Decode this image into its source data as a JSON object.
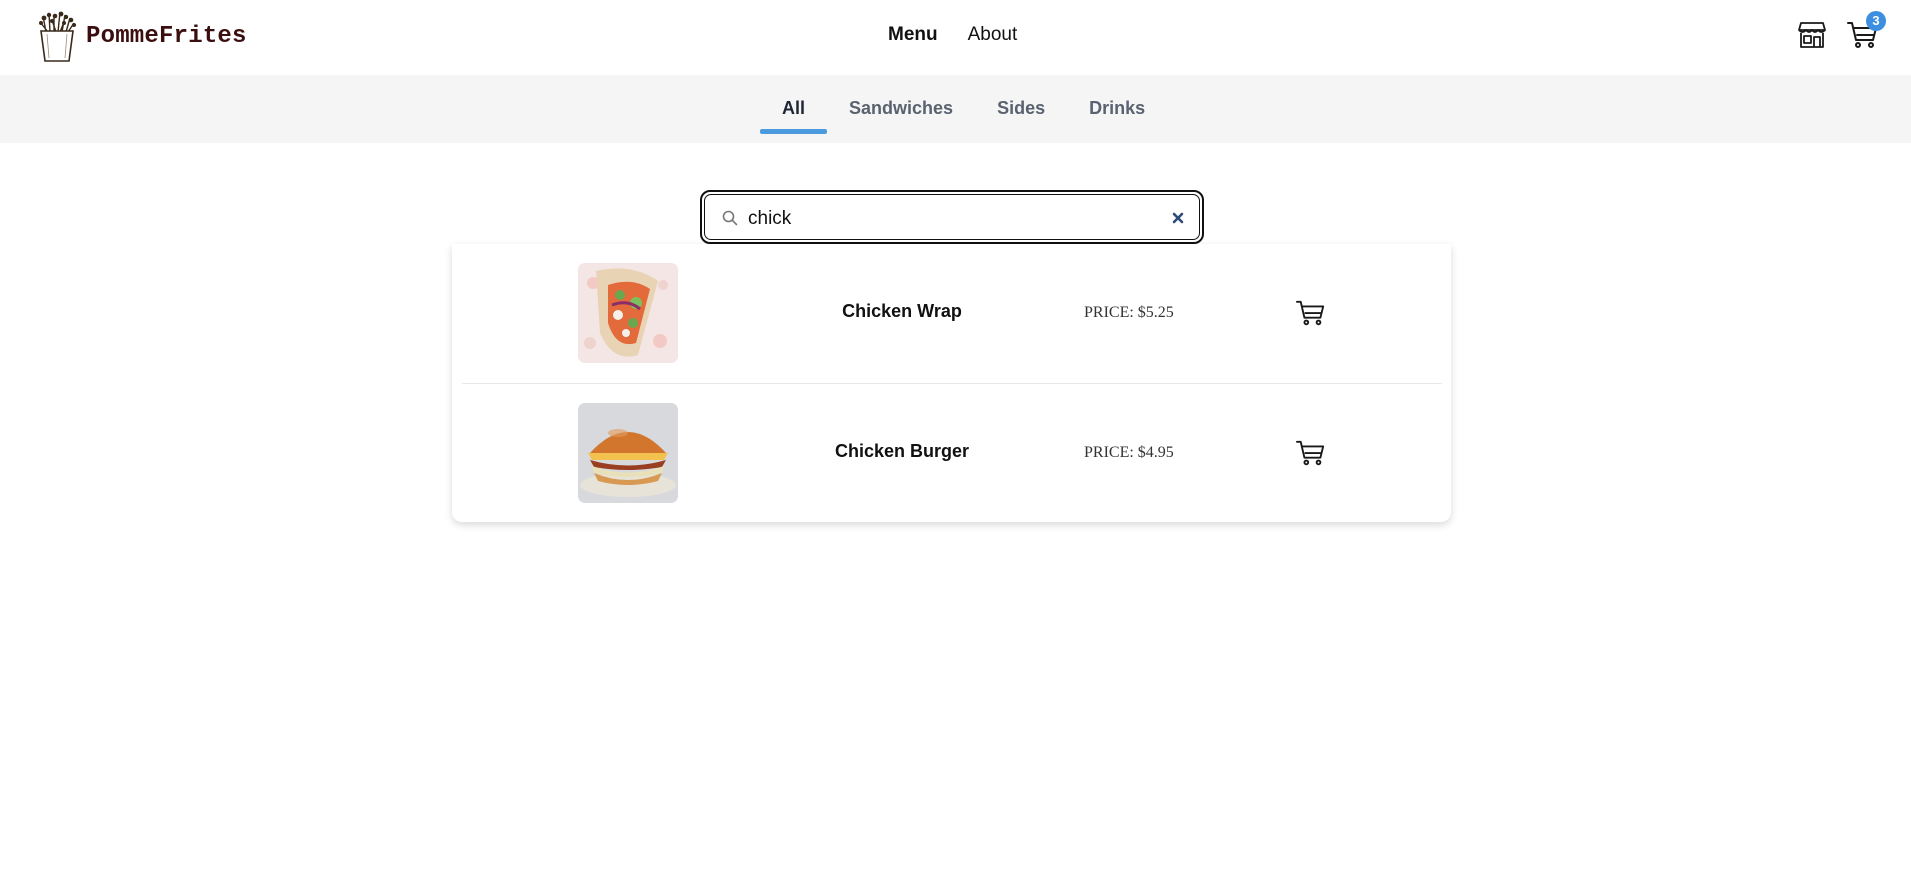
{
  "brand": {
    "name": "PommeFrites",
    "logo_icon": "fries-logo-icon"
  },
  "nav": {
    "items": [
      {
        "label": "Menu",
        "active": true
      },
      {
        "label": "About",
        "active": false
      }
    ]
  },
  "header_icons": {
    "store_icon": "store-icon",
    "cart_icon": "cart-icon",
    "cart_count": "3"
  },
  "categories": [
    {
      "label": "All",
      "active": true
    },
    {
      "label": "Sandwiches",
      "active": false
    },
    {
      "label": "Sides",
      "active": false
    },
    {
      "label": "Drinks",
      "active": false
    }
  ],
  "search": {
    "value": "chick",
    "placeholder": ""
  },
  "results": [
    {
      "name": "Chicken Wrap",
      "price": "PRICE: $5.25",
      "image": "chicken-wrap-photo"
    },
    {
      "name": "Chicken Burger",
      "price": "PRICE: $4.95",
      "image": "chicken-burger-photo"
    }
  ],
  "colors": {
    "accent": "#4b9ae0",
    "badge": "#3b8fde",
    "brand_text": "#3b0f0f",
    "category_bar": "#f5f5f5"
  }
}
